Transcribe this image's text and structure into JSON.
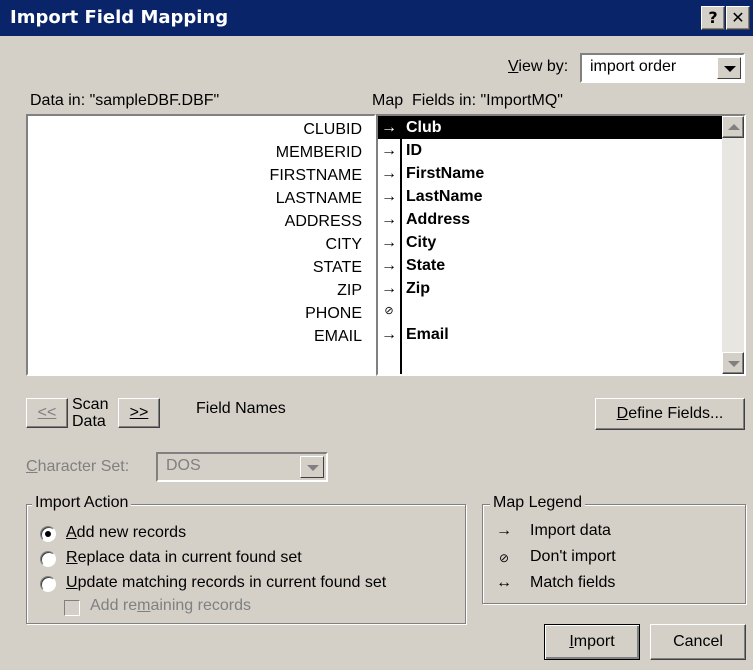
{
  "window": {
    "title": "Import Field Mapping",
    "help_label": "?",
    "close_label": "✕"
  },
  "view_by": {
    "label": "View by:",
    "value": "import order"
  },
  "source": {
    "header": "Data in: \"sampleDBF.DBF\"",
    "fields": [
      "CLUBID",
      "MEMBERID",
      "FIRSTNAME",
      "LASTNAME",
      "ADDRESS",
      "CITY",
      "STATE",
      "ZIP",
      "PHONE",
      "EMAIL"
    ]
  },
  "mapping": {
    "map_header": "Map",
    "dest_header": "Fields in: \"ImportMQ\"",
    "symbols": [
      "→",
      "→",
      "→",
      "→",
      "→",
      "→",
      "→",
      "→",
      "⊘",
      "→"
    ],
    "fields": [
      "Club",
      "ID",
      "FirstName",
      "LastName",
      "Address",
      "City",
      "State",
      "Zip",
      "",
      "Email"
    ]
  },
  "scan": {
    "prev_label": "<<",
    "next_label": ">>",
    "scan_line1": "Scan",
    "scan_line2": "Data",
    "field_names_label": "Field Names"
  },
  "define_fields_label": "Define Fields...",
  "character_set": {
    "label": "Character Set:",
    "value": "DOS"
  },
  "import_action": {
    "title": "Import Action",
    "options": [
      "Add new records",
      "Replace data in current found set",
      "Update matching records in current found set"
    ],
    "selected_index": 0,
    "add_remaining_label": "Add remaining records"
  },
  "legend": {
    "title": "Map Legend",
    "items": [
      {
        "symbol": "→",
        "label": "Import data"
      },
      {
        "symbol": "⊘",
        "label": "Don't import"
      },
      {
        "symbol": "↔",
        "label": "Match fields"
      }
    ]
  },
  "buttons": {
    "import_label": "Import",
    "cancel_label": "Cancel"
  }
}
